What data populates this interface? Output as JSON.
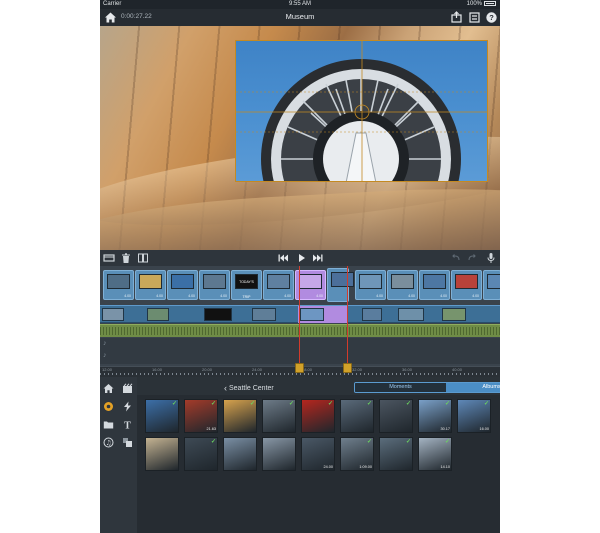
{
  "status_bar": {
    "carrier": "Carrier",
    "time": "9:55 AM",
    "battery": "100%"
  },
  "header": {
    "timecode": "0:00:27.22",
    "title": "Museum"
  },
  "timeline": {
    "clip_durations": [
      "4.00",
      "4.00",
      "4.00",
      "4.00",
      "",
      "4.00",
      "4.00",
      "",
      "4.00",
      "4.00",
      "4.00",
      "4.00",
      ""
    ],
    "ruler_ticks": [
      "12.00",
      "16.00",
      "20.00",
      "24.00",
      "28.00",
      "32.00",
      "36.00",
      "40.00",
      "44.00",
      "48.00",
      "52.00"
    ],
    "title_clip_text": "TODAY'S TRIP"
  },
  "browser": {
    "back_label": "Seattle Center",
    "tabs": {
      "moments": "Moments",
      "albums": "Albums"
    },
    "photo_times": [
      "",
      "21.63",
      "",
      "",
      "",
      "",
      "",
      "30.17",
      "16.00",
      "",
      "",
      "",
      "",
      "24.00",
      "1:09.00",
      "",
      "14.10"
    ]
  },
  "colors": {
    "accent": "#4b8ec6",
    "selected_clip": "#b18be0",
    "crop_frame": "#c48a22",
    "playhead": "#d23b2c",
    "check": "#6ad35f"
  }
}
